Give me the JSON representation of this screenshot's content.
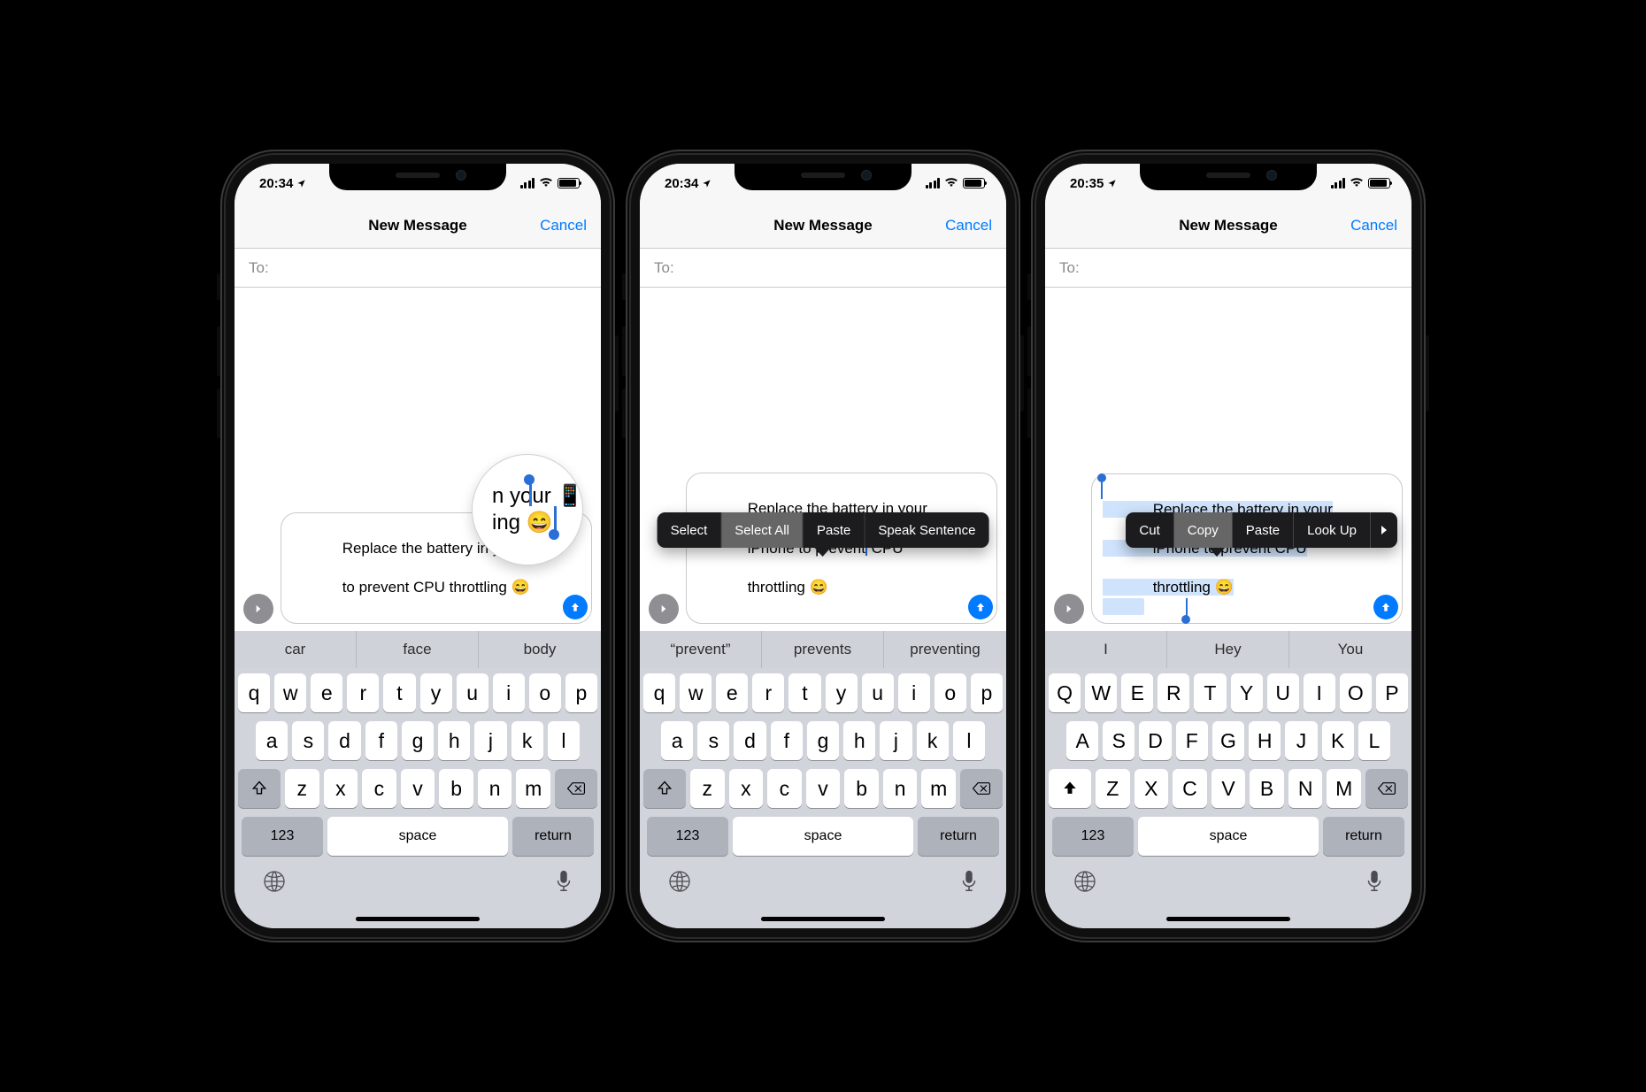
{
  "screens": [
    {
      "statusbar": {
        "time": "20:34",
        "has_location": true
      },
      "nav": {
        "title": "New Message",
        "cancel": "Cancel"
      },
      "torow": {
        "label": "To:"
      },
      "compose": {
        "line1": "Replace the battery in your 📱",
        "line2": "to prevent CPU throttling 😄"
      },
      "loupe": {
        "line1": "n your 📱",
        "line2": "ing 😄"
      },
      "predictions": [
        "car",
        "face",
        "body"
      ],
      "keyboard": {
        "rows": [
          [
            "q",
            "w",
            "e",
            "r",
            "t",
            "y",
            "u",
            "i",
            "o",
            "p"
          ],
          [
            "a",
            "s",
            "d",
            "f",
            "g",
            "h",
            "j",
            "k",
            "l"
          ],
          [
            "z",
            "x",
            "c",
            "v",
            "b",
            "n",
            "m"
          ]
        ],
        "num": "123",
        "space": "space",
        "return": "return",
        "shift_filled": false,
        "caps": false
      }
    },
    {
      "statusbar": {
        "time": "20:34",
        "has_location": true
      },
      "nav": {
        "title": "New Message",
        "cancel": "Cancel"
      },
      "torow": {
        "label": "To:"
      },
      "compose": {
        "line1": "Replace the battery in your",
        "line2": "iPhone to prevent CPU",
        "line3": "throttling 😄"
      },
      "edit_menu": {
        "items": [
          "Select",
          "Select All",
          "Paste",
          "Speak Sentence"
        ],
        "selected_index": 1
      },
      "predictions": [
        "“prevent”",
        "prevents",
        "preventing"
      ],
      "keyboard": {
        "rows": [
          [
            "q",
            "w",
            "e",
            "r",
            "t",
            "y",
            "u",
            "i",
            "o",
            "p"
          ],
          [
            "a",
            "s",
            "d",
            "f",
            "g",
            "h",
            "j",
            "k",
            "l"
          ],
          [
            "z",
            "x",
            "c",
            "v",
            "b",
            "n",
            "m"
          ]
        ],
        "num": "123",
        "space": "space",
        "return": "return",
        "shift_filled": false,
        "caps": false
      }
    },
    {
      "statusbar": {
        "time": "20:35",
        "has_location": true
      },
      "nav": {
        "title": "New Message",
        "cancel": "Cancel"
      },
      "torow": {
        "label": "To:"
      },
      "compose": {
        "line1": "Replace the battery in your",
        "line2": "iPhone to prevent CPU",
        "line3": "throttling 😄",
        "selected": true
      },
      "edit_menu": {
        "items": [
          "Cut",
          "Copy",
          "Paste",
          "Look Up"
        ],
        "selected_index": 1,
        "has_more": true
      },
      "predictions": [
        "I",
        "Hey",
        "You"
      ],
      "keyboard": {
        "rows": [
          [
            "Q",
            "W",
            "E",
            "R",
            "T",
            "Y",
            "U",
            "I",
            "O",
            "P"
          ],
          [
            "A",
            "S",
            "D",
            "F",
            "G",
            "H",
            "J",
            "K",
            "L"
          ],
          [
            "Z",
            "X",
            "C",
            "V",
            "B",
            "N",
            "M"
          ]
        ],
        "num": "123",
        "space": "space",
        "return": "return",
        "shift_filled": true,
        "caps": true
      }
    }
  ]
}
